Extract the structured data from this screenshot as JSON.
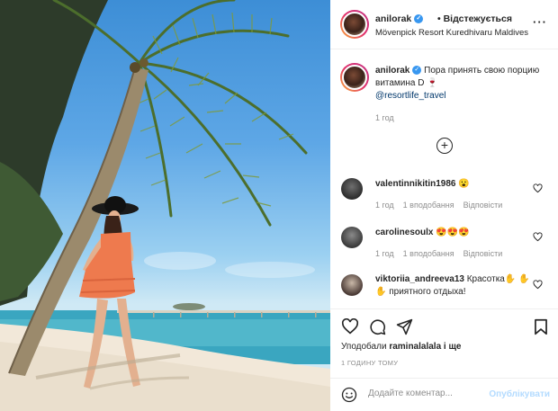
{
  "post": {
    "author": "anilorak",
    "follow_label": "• Відстежується",
    "location": "Mövenpick Resort Kuredhivaru Maldives",
    "caption_text": "Пора принять свою порцию витамина D 🍷",
    "caption_mention": "@resortlife_travel",
    "caption_time": "1 год"
  },
  "icons": {
    "more": "more-options-icon",
    "verified": "verified-badge-icon",
    "load_more": "plus-circle-icon",
    "like": "heart-icon",
    "comment": "comment-bubble-icon",
    "share": "paper-plane-icon",
    "save": "bookmark-icon",
    "emoji": "smiley-face-icon"
  },
  "comments": [
    {
      "user": "valentinnikitin1986",
      "text": "😮",
      "time": "1 год",
      "replies": "1 вподобання",
      "reply_label": "Відповісти"
    },
    {
      "user": "carolinesoulx",
      "text": "😍😍😍",
      "time": "1 год",
      "replies": "1 вподобання",
      "reply_label": "Відповісти"
    },
    {
      "user": "viktoriia_andreeva13",
      "text": "Красотка✋ ✋✋ приятного отдыха!"
    }
  ],
  "footer": {
    "likes_prefix": "Уподобали",
    "likes_user": "raminalalala",
    "likes_suffix": "і ще",
    "time_ago": "1 ГОДИНУ ТОМУ",
    "input_placeholder": "Додайте коментар...",
    "publish_label": "Опублікувати"
  },
  "colors": {
    "verified_blue": "#3897f0",
    "link_blue": "#00376b",
    "publish_disabled": "#b3dbff",
    "muted_text": "#8e8e8e"
  }
}
